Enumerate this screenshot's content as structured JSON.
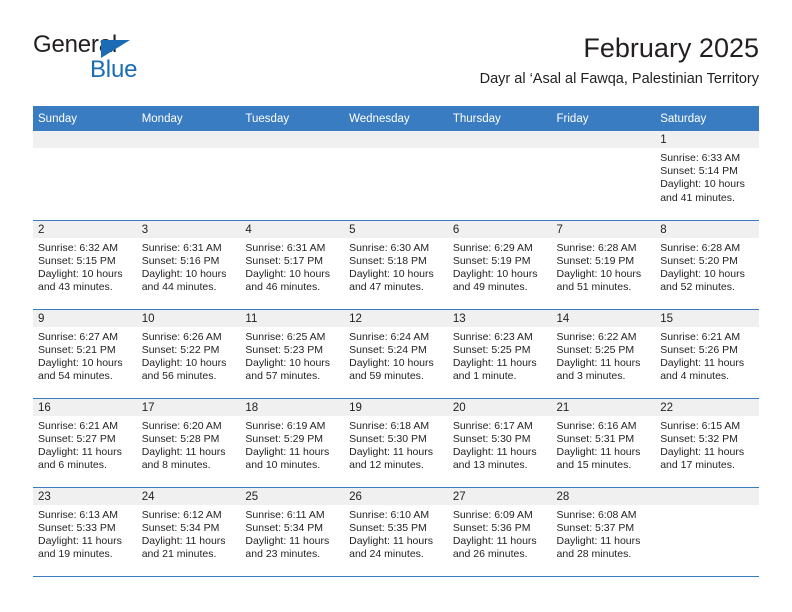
{
  "brand": {
    "line1": "General",
    "line2": "Blue",
    "accent_color": "#1b6cb5",
    "triangle_icon": "blue-triangle-logo-mark"
  },
  "header": {
    "title": "February 2025",
    "subtitle": "Dayr al ‘Asal al Fawqa, Palestinian Territory"
  },
  "theme": {
    "header_row_bg": "#3a7cc2",
    "header_row_text": "#ffffff",
    "daynum_band_bg": "#f0f0f0",
    "row_rule": "#3a7cc2",
    "body_text": "#231f20"
  },
  "calendar": {
    "weekday_headers": [
      "Sunday",
      "Monday",
      "Tuesday",
      "Wednesday",
      "Thursday",
      "Friday",
      "Saturday"
    ],
    "weeks": [
      [
        {
          "day": "",
          "lines": []
        },
        {
          "day": "",
          "lines": []
        },
        {
          "day": "",
          "lines": []
        },
        {
          "day": "",
          "lines": []
        },
        {
          "day": "",
          "lines": []
        },
        {
          "day": "",
          "lines": []
        },
        {
          "day": "1",
          "lines": [
            "Sunrise: 6:33 AM",
            "Sunset: 5:14 PM",
            "Daylight: 10 hours",
            "and 41 minutes."
          ]
        }
      ],
      [
        {
          "day": "2",
          "lines": [
            "Sunrise: 6:32 AM",
            "Sunset: 5:15 PM",
            "Daylight: 10 hours",
            "and 43 minutes."
          ]
        },
        {
          "day": "3",
          "lines": [
            "Sunrise: 6:31 AM",
            "Sunset: 5:16 PM",
            "Daylight: 10 hours",
            "and 44 minutes."
          ]
        },
        {
          "day": "4",
          "lines": [
            "Sunrise: 6:31 AM",
            "Sunset: 5:17 PM",
            "Daylight: 10 hours",
            "and 46 minutes."
          ]
        },
        {
          "day": "5",
          "lines": [
            "Sunrise: 6:30 AM",
            "Sunset: 5:18 PM",
            "Daylight: 10 hours",
            "and 47 minutes."
          ]
        },
        {
          "day": "6",
          "lines": [
            "Sunrise: 6:29 AM",
            "Sunset: 5:19 PM",
            "Daylight: 10 hours",
            "and 49 minutes."
          ]
        },
        {
          "day": "7",
          "lines": [
            "Sunrise: 6:28 AM",
            "Sunset: 5:19 PM",
            "Daylight: 10 hours",
            "and 51 minutes."
          ]
        },
        {
          "day": "8",
          "lines": [
            "Sunrise: 6:28 AM",
            "Sunset: 5:20 PM",
            "Daylight: 10 hours",
            "and 52 minutes."
          ]
        }
      ],
      [
        {
          "day": "9",
          "lines": [
            "Sunrise: 6:27 AM",
            "Sunset: 5:21 PM",
            "Daylight: 10 hours",
            "and 54 minutes."
          ]
        },
        {
          "day": "10",
          "lines": [
            "Sunrise: 6:26 AM",
            "Sunset: 5:22 PM",
            "Daylight: 10 hours",
            "and 56 minutes."
          ]
        },
        {
          "day": "11",
          "lines": [
            "Sunrise: 6:25 AM",
            "Sunset: 5:23 PM",
            "Daylight: 10 hours",
            "and 57 minutes."
          ]
        },
        {
          "day": "12",
          "lines": [
            "Sunrise: 6:24 AM",
            "Sunset: 5:24 PM",
            "Daylight: 10 hours",
            "and 59 minutes."
          ]
        },
        {
          "day": "13",
          "lines": [
            "Sunrise: 6:23 AM",
            "Sunset: 5:25 PM",
            "Daylight: 11 hours",
            "and 1 minute."
          ]
        },
        {
          "day": "14",
          "lines": [
            "Sunrise: 6:22 AM",
            "Sunset: 5:25 PM",
            "Daylight: 11 hours",
            "and 3 minutes."
          ]
        },
        {
          "day": "15",
          "lines": [
            "Sunrise: 6:21 AM",
            "Sunset: 5:26 PM",
            "Daylight: 11 hours",
            "and 4 minutes."
          ]
        }
      ],
      [
        {
          "day": "16",
          "lines": [
            "Sunrise: 6:21 AM",
            "Sunset: 5:27 PM",
            "Daylight: 11 hours",
            "and 6 minutes."
          ]
        },
        {
          "day": "17",
          "lines": [
            "Sunrise: 6:20 AM",
            "Sunset: 5:28 PM",
            "Daylight: 11 hours",
            "and 8 minutes."
          ]
        },
        {
          "day": "18",
          "lines": [
            "Sunrise: 6:19 AM",
            "Sunset: 5:29 PM",
            "Daylight: 11 hours",
            "and 10 minutes."
          ]
        },
        {
          "day": "19",
          "lines": [
            "Sunrise: 6:18 AM",
            "Sunset: 5:30 PM",
            "Daylight: 11 hours",
            "and 12 minutes."
          ]
        },
        {
          "day": "20",
          "lines": [
            "Sunrise: 6:17 AM",
            "Sunset: 5:30 PM",
            "Daylight: 11 hours",
            "and 13 minutes."
          ]
        },
        {
          "day": "21",
          "lines": [
            "Sunrise: 6:16 AM",
            "Sunset: 5:31 PM",
            "Daylight: 11 hours",
            "and 15 minutes."
          ]
        },
        {
          "day": "22",
          "lines": [
            "Sunrise: 6:15 AM",
            "Sunset: 5:32 PM",
            "Daylight: 11 hours",
            "and 17 minutes."
          ]
        }
      ],
      [
        {
          "day": "23",
          "lines": [
            "Sunrise: 6:13 AM",
            "Sunset: 5:33 PM",
            "Daylight: 11 hours",
            "and 19 minutes."
          ]
        },
        {
          "day": "24",
          "lines": [
            "Sunrise: 6:12 AM",
            "Sunset: 5:34 PM",
            "Daylight: 11 hours",
            "and 21 minutes."
          ]
        },
        {
          "day": "25",
          "lines": [
            "Sunrise: 6:11 AM",
            "Sunset: 5:34 PM",
            "Daylight: 11 hours",
            "and 23 minutes."
          ]
        },
        {
          "day": "26",
          "lines": [
            "Sunrise: 6:10 AM",
            "Sunset: 5:35 PM",
            "Daylight: 11 hours",
            "and 24 minutes."
          ]
        },
        {
          "day": "27",
          "lines": [
            "Sunrise: 6:09 AM",
            "Sunset: 5:36 PM",
            "Daylight: 11 hours",
            "and 26 minutes."
          ]
        },
        {
          "day": "28",
          "lines": [
            "Sunrise: 6:08 AM",
            "Sunset: 5:37 PM",
            "Daylight: 11 hours",
            "and 28 minutes."
          ]
        },
        {
          "day": "",
          "lines": []
        }
      ]
    ]
  }
}
